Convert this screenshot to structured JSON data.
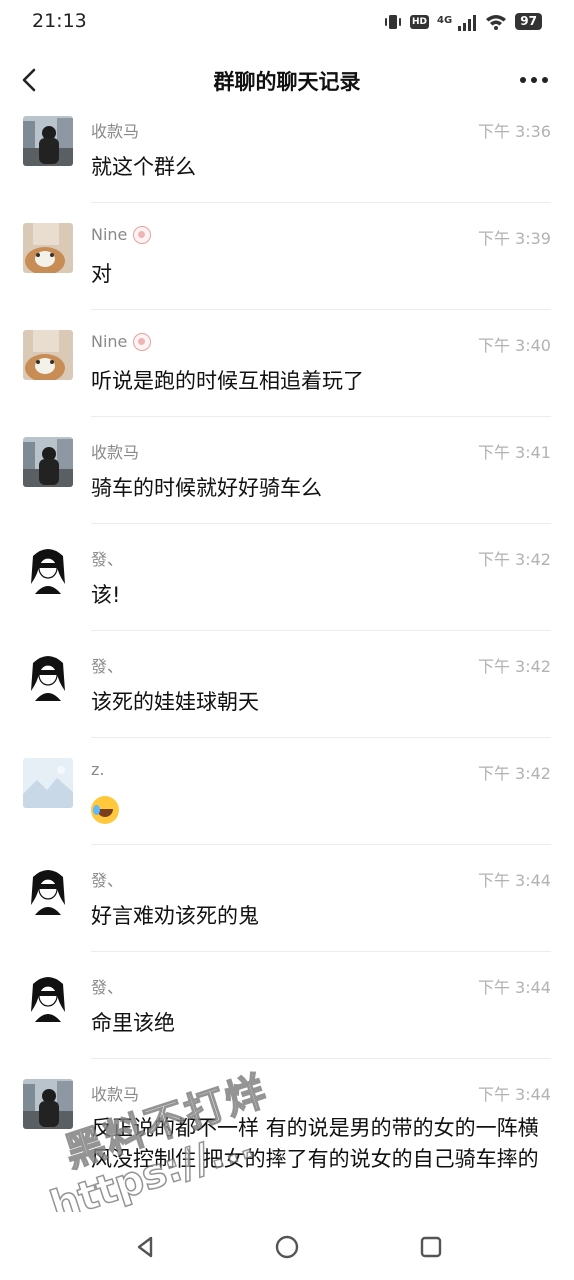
{
  "status_bar": {
    "time": "21:13",
    "battery": "97",
    "network_label": "4G",
    "hd_label": "HD",
    "icons": [
      "vibrate-icon",
      "hd-icon",
      "signal-icon",
      "wifi-icon",
      "battery-icon"
    ]
  },
  "nav": {
    "title": "群聊的聊天记录",
    "back_icon": "chevron-left-icon",
    "more_icon": "more-dots-icon"
  },
  "messages": [
    {
      "sender": "收款马",
      "time": "下午 3:36",
      "text": "就这个群么",
      "badge": false,
      "avatar": "avatar-photo-city"
    },
    {
      "sender": "Nine",
      "time": "下午 3:39",
      "text": "对",
      "badge": true,
      "avatar": "avatar-photo-cat"
    },
    {
      "sender": "Nine",
      "time": "下午 3:40",
      "text": "听说是跑的时候互相追着玩了",
      "badge": true,
      "avatar": "avatar-photo-cat"
    },
    {
      "sender": "收款马",
      "time": "下午 3:41",
      "text": "骑车的时候就好好骑车么",
      "badge": false,
      "avatar": "avatar-photo-city"
    },
    {
      "sender": "發、",
      "time": "下午 3:42",
      "text": "该!",
      "badge": false,
      "avatar": "avatar-drawing-girl"
    },
    {
      "sender": "發、",
      "time": "下午 3:42",
      "text": "该死的娃娃球朝天",
      "badge": false,
      "avatar": "avatar-drawing-girl"
    },
    {
      "sender": "z.",
      "time": "下午 3:42",
      "text": "",
      "emoji": "crying-laughing-emoji",
      "badge": false,
      "avatar": "avatar-landscape"
    },
    {
      "sender": "發、",
      "time": "下午 3:44",
      "text": "好言难劝该死的鬼",
      "badge": false,
      "avatar": "avatar-drawing-girl"
    },
    {
      "sender": "發、",
      "time": "下午 3:44",
      "text": "命里该绝",
      "badge": false,
      "avatar": "avatar-drawing-girl"
    },
    {
      "sender": "收款马",
      "time": "下午 3:44",
      "text": "反正说的都不一样 有的说是男的带的女的一阵横风没控制住 把女的摔了有的说女的自己骑车摔的",
      "badge": false,
      "avatar": "avatar-photo-city"
    }
  ],
  "watermark": {
    "line1": "黑料不打烊",
    "line2": "https://..."
  },
  "bottom_nav": {
    "icons": [
      "back-triangle-icon",
      "home-circle-icon",
      "recents-square-icon"
    ]
  },
  "colors": {
    "time_gray": "#b2b2b2",
    "sender_gray": "#8a8a8a",
    "divider": "#ececec"
  }
}
